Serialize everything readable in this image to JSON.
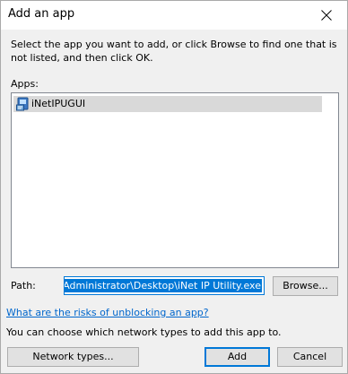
{
  "window": {
    "title": "Add an app"
  },
  "description": "Select the app you want to add, or click Browse to find one that is not listed, and then click OK.",
  "apps": {
    "label": "Apps:",
    "items": [
      {
        "label": "iNetIPUGUI",
        "icon": "app-icon",
        "selected": true
      }
    ]
  },
  "path": {
    "label": "Path:",
    "value": "ers\\Administrator\\Desktop\\iNet IP Utility.exe"
  },
  "buttons": {
    "browse": "Browse...",
    "network_types": "Network types...",
    "add": "Add",
    "cancel": "Cancel"
  },
  "links": {
    "risks": "What are the risks of unblocking an app?"
  },
  "network_text": "You can choose which network types to add this app to.",
  "colors": {
    "accent": "#0078d7",
    "link": "#0066cc",
    "selection_bg": "#d9d9d9"
  }
}
